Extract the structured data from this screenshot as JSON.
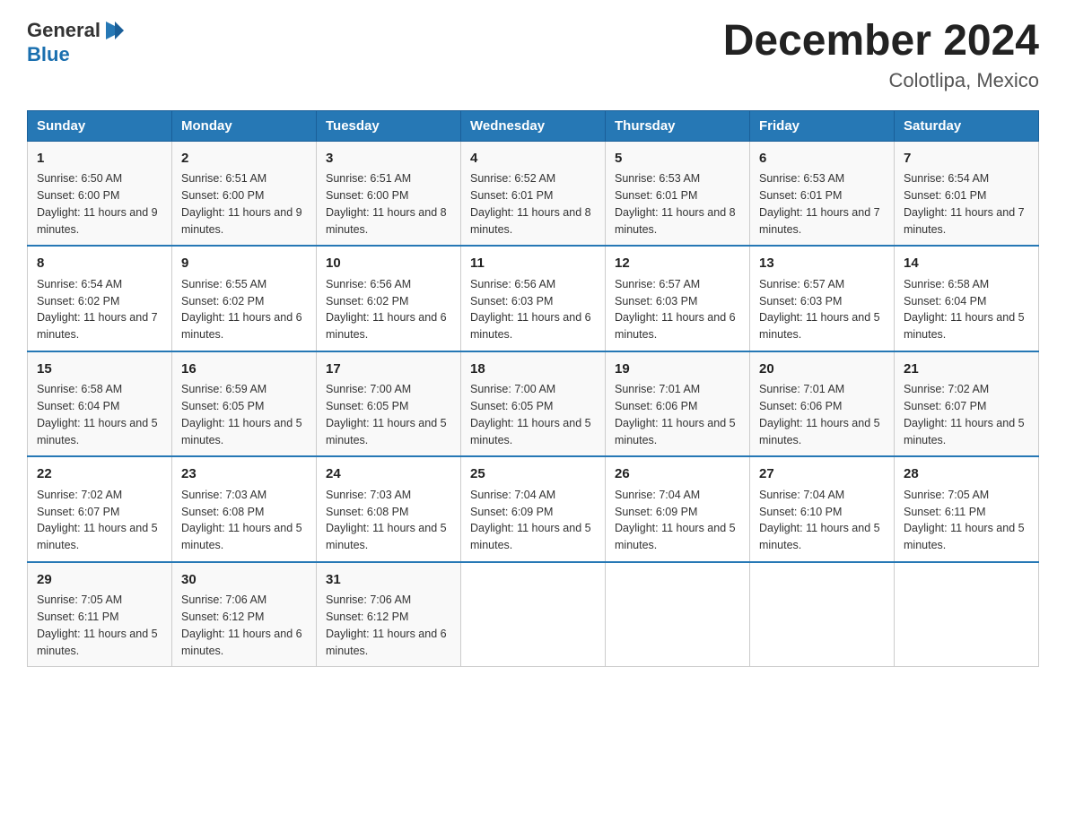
{
  "header": {
    "logo_general": "General",
    "logo_blue": "Blue",
    "month_title": "December 2024",
    "location": "Colotlipa, Mexico"
  },
  "weekdays": [
    "Sunday",
    "Monday",
    "Tuesday",
    "Wednesday",
    "Thursday",
    "Friday",
    "Saturday"
  ],
  "weeks": [
    [
      {
        "day": "1",
        "sunrise": "6:50 AM",
        "sunset": "6:00 PM",
        "daylight": "11 hours and 9 minutes."
      },
      {
        "day": "2",
        "sunrise": "6:51 AM",
        "sunset": "6:00 PM",
        "daylight": "11 hours and 9 minutes."
      },
      {
        "day": "3",
        "sunrise": "6:51 AM",
        "sunset": "6:00 PM",
        "daylight": "11 hours and 8 minutes."
      },
      {
        "day": "4",
        "sunrise": "6:52 AM",
        "sunset": "6:01 PM",
        "daylight": "11 hours and 8 minutes."
      },
      {
        "day": "5",
        "sunrise": "6:53 AM",
        "sunset": "6:01 PM",
        "daylight": "11 hours and 8 minutes."
      },
      {
        "day": "6",
        "sunrise": "6:53 AM",
        "sunset": "6:01 PM",
        "daylight": "11 hours and 7 minutes."
      },
      {
        "day": "7",
        "sunrise": "6:54 AM",
        "sunset": "6:01 PM",
        "daylight": "11 hours and 7 minutes."
      }
    ],
    [
      {
        "day": "8",
        "sunrise": "6:54 AM",
        "sunset": "6:02 PM",
        "daylight": "11 hours and 7 minutes."
      },
      {
        "day": "9",
        "sunrise": "6:55 AM",
        "sunset": "6:02 PM",
        "daylight": "11 hours and 6 minutes."
      },
      {
        "day": "10",
        "sunrise": "6:56 AM",
        "sunset": "6:02 PM",
        "daylight": "11 hours and 6 minutes."
      },
      {
        "day": "11",
        "sunrise": "6:56 AM",
        "sunset": "6:03 PM",
        "daylight": "11 hours and 6 minutes."
      },
      {
        "day": "12",
        "sunrise": "6:57 AM",
        "sunset": "6:03 PM",
        "daylight": "11 hours and 6 minutes."
      },
      {
        "day": "13",
        "sunrise": "6:57 AM",
        "sunset": "6:03 PM",
        "daylight": "11 hours and 5 minutes."
      },
      {
        "day": "14",
        "sunrise": "6:58 AM",
        "sunset": "6:04 PM",
        "daylight": "11 hours and 5 minutes."
      }
    ],
    [
      {
        "day": "15",
        "sunrise": "6:58 AM",
        "sunset": "6:04 PM",
        "daylight": "11 hours and 5 minutes."
      },
      {
        "day": "16",
        "sunrise": "6:59 AM",
        "sunset": "6:05 PM",
        "daylight": "11 hours and 5 minutes."
      },
      {
        "day": "17",
        "sunrise": "7:00 AM",
        "sunset": "6:05 PM",
        "daylight": "11 hours and 5 minutes."
      },
      {
        "day": "18",
        "sunrise": "7:00 AM",
        "sunset": "6:05 PM",
        "daylight": "11 hours and 5 minutes."
      },
      {
        "day": "19",
        "sunrise": "7:01 AM",
        "sunset": "6:06 PM",
        "daylight": "11 hours and 5 minutes."
      },
      {
        "day": "20",
        "sunrise": "7:01 AM",
        "sunset": "6:06 PM",
        "daylight": "11 hours and 5 minutes."
      },
      {
        "day": "21",
        "sunrise": "7:02 AM",
        "sunset": "6:07 PM",
        "daylight": "11 hours and 5 minutes."
      }
    ],
    [
      {
        "day": "22",
        "sunrise": "7:02 AM",
        "sunset": "6:07 PM",
        "daylight": "11 hours and 5 minutes."
      },
      {
        "day": "23",
        "sunrise": "7:03 AM",
        "sunset": "6:08 PM",
        "daylight": "11 hours and 5 minutes."
      },
      {
        "day": "24",
        "sunrise": "7:03 AM",
        "sunset": "6:08 PM",
        "daylight": "11 hours and 5 minutes."
      },
      {
        "day": "25",
        "sunrise": "7:04 AM",
        "sunset": "6:09 PM",
        "daylight": "11 hours and 5 minutes."
      },
      {
        "day": "26",
        "sunrise": "7:04 AM",
        "sunset": "6:09 PM",
        "daylight": "11 hours and 5 minutes."
      },
      {
        "day": "27",
        "sunrise": "7:04 AM",
        "sunset": "6:10 PM",
        "daylight": "11 hours and 5 minutes."
      },
      {
        "day": "28",
        "sunrise": "7:05 AM",
        "sunset": "6:11 PM",
        "daylight": "11 hours and 5 minutes."
      }
    ],
    [
      {
        "day": "29",
        "sunrise": "7:05 AM",
        "sunset": "6:11 PM",
        "daylight": "11 hours and 5 minutes."
      },
      {
        "day": "30",
        "sunrise": "7:06 AM",
        "sunset": "6:12 PM",
        "daylight": "11 hours and 6 minutes."
      },
      {
        "day": "31",
        "sunrise": "7:06 AM",
        "sunset": "6:12 PM",
        "daylight": "11 hours and 6 minutes."
      },
      null,
      null,
      null,
      null
    ]
  ]
}
